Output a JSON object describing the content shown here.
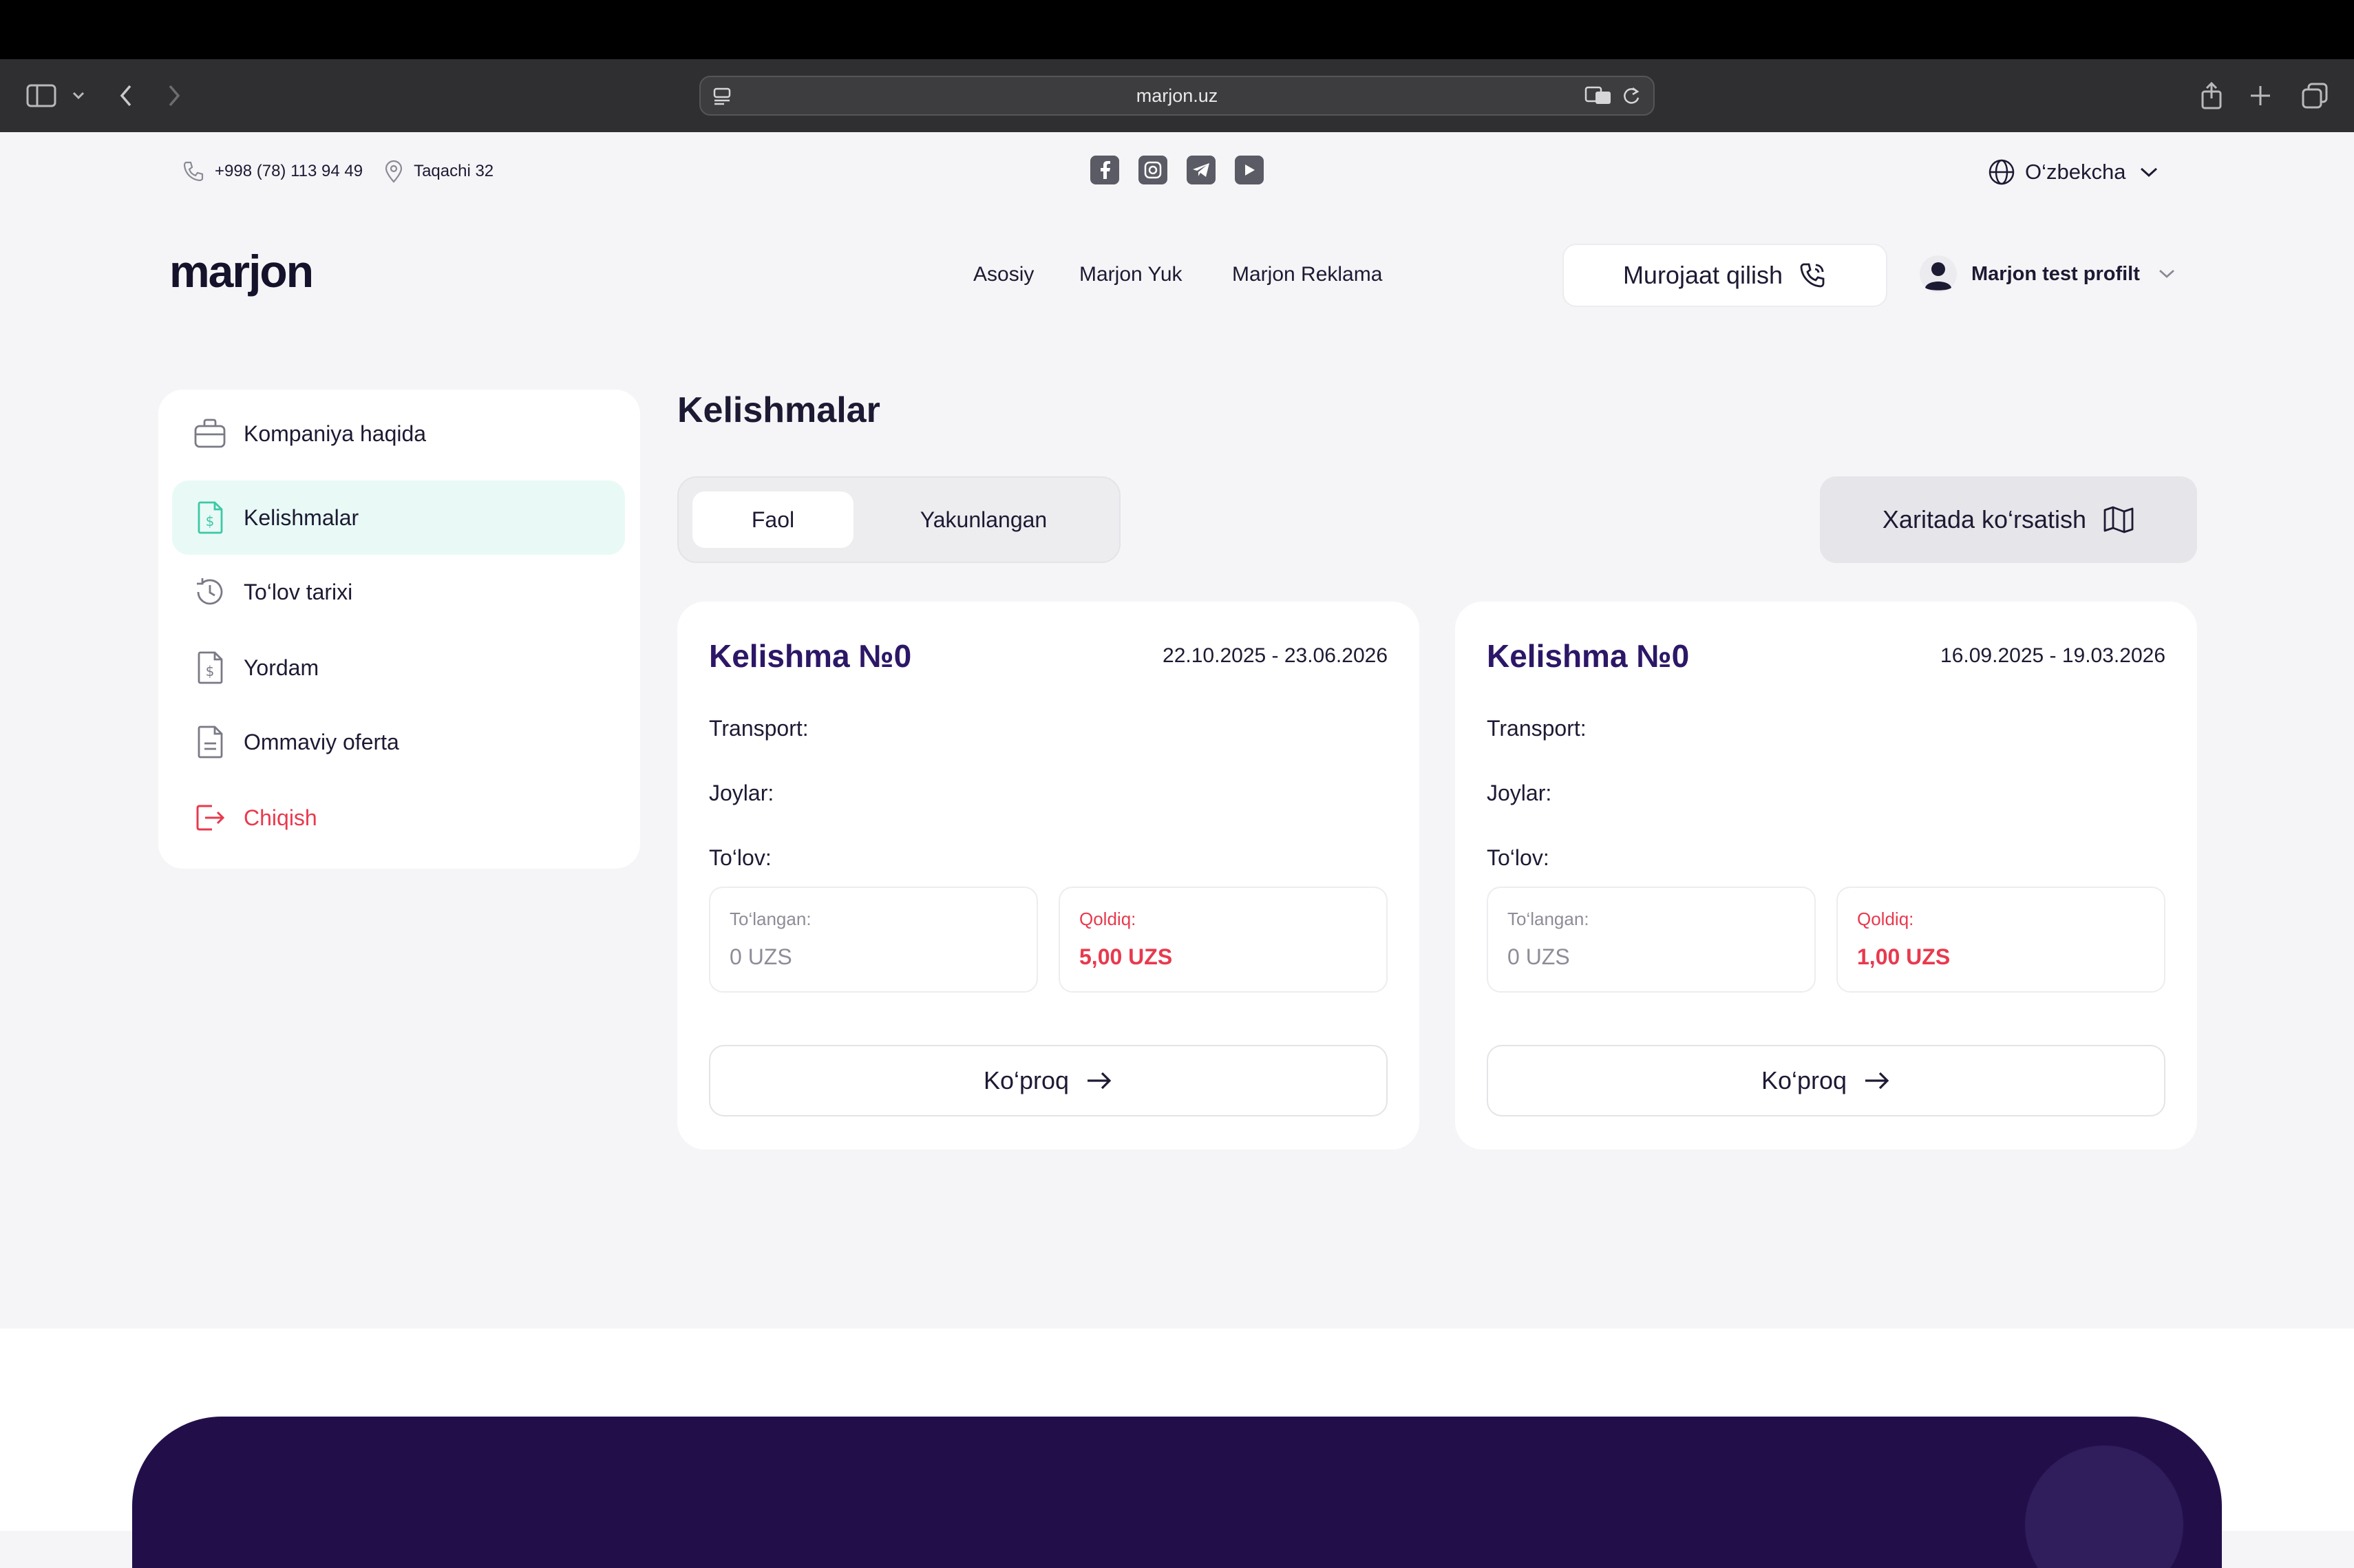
{
  "browser": {
    "url": "marjon.uz"
  },
  "topinfo": {
    "phone": "+998 (78) 113 94 49",
    "address": "Taqachi 32",
    "language": "O‘zbekcha"
  },
  "header": {
    "logo": "marjon",
    "nav": [
      "Asosiy",
      "Marjon Yuk",
      "Marjon Reklama"
    ],
    "contact_button": "Murojaat qilish",
    "profile_name": "Marjon test profilt"
  },
  "sidebar": {
    "items": [
      {
        "label": "Kompaniya haqida"
      },
      {
        "label": "Kelishmalar"
      },
      {
        "label": "To‘lov tarixi"
      },
      {
        "label": "Yordam"
      },
      {
        "label": "Ommaviy oferta"
      },
      {
        "label": "Chiqish"
      }
    ]
  },
  "main": {
    "title": "Kelishmalar",
    "tabs": [
      "Faol",
      "Yakunlangan"
    ],
    "map_button": "Xaritada ko‘rsatish"
  },
  "cards": [
    {
      "title": "Kelishma №0",
      "dates": "22.10.2025 - 23.06.2026",
      "transport_label": "Transport:",
      "places_label": "Joylar:",
      "payment_label": "To‘lov:",
      "paid_label": "To‘langan:",
      "paid_value": "0 UZS",
      "remaining_label": "Qoldiq:",
      "remaining_value": "5,00 UZS",
      "more_button": "Ko‘proq"
    },
    {
      "title": "Kelishma №0",
      "dates": "16.09.2025 - 19.03.2026",
      "transport_label": "Transport:",
      "places_label": "Joylar:",
      "payment_label": "To‘lov:",
      "paid_label": "To‘langan:",
      "paid_value": "0 UZS",
      "remaining_label": "Qoldiq:",
      "remaining_value": "1,00 UZS",
      "more_button": "Ko‘proq"
    }
  ],
  "colors": {
    "accent_green": "#3ec8a6",
    "active_bg": "#e9faf6",
    "danger": "#e8394e",
    "title_purple": "#2c1767",
    "footer_purple": "#220f4a"
  }
}
